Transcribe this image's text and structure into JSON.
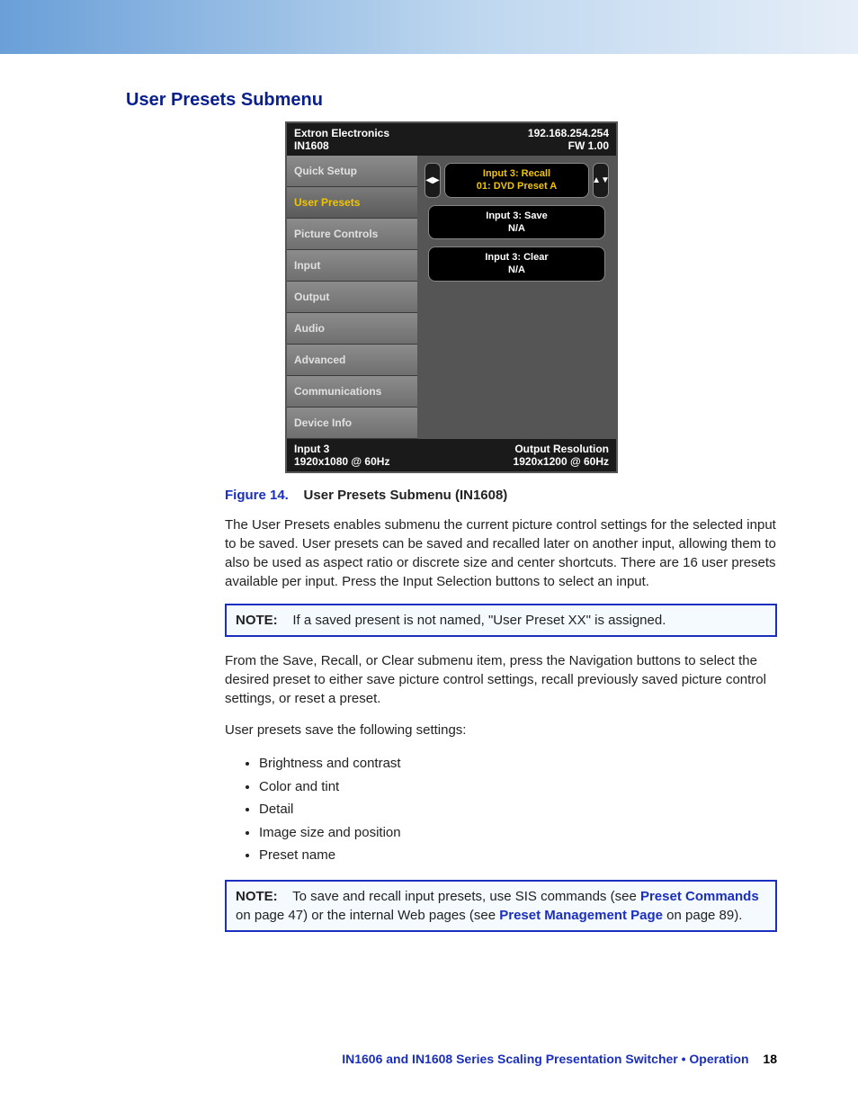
{
  "section_title": "User Presets Submenu",
  "device": {
    "brand": "Extron Electronics",
    "model": "IN1608",
    "ip": "192.168.254.254",
    "fw": "FW 1.00",
    "menu": [
      {
        "label": "Quick Setup",
        "selected": false
      },
      {
        "label": "User Presets",
        "selected": true
      },
      {
        "label": "Picture Controls",
        "selected": false
      },
      {
        "label": "Input",
        "selected": false
      },
      {
        "label": "Output",
        "selected": false
      },
      {
        "label": "Audio",
        "selected": false
      },
      {
        "label": "Advanced",
        "selected": false
      },
      {
        "label": "Communications",
        "selected": false
      },
      {
        "label": "Device Info",
        "selected": false
      }
    ],
    "pane": {
      "recall_l1": "Input 3: Recall",
      "recall_l2": "01: DVD Preset A",
      "save_l1": "Input 3: Save",
      "save_l2": "N/A",
      "clear_l1": "Input 3: Clear",
      "clear_l2": "N/A"
    },
    "footer": {
      "input_label": "Input 3",
      "input_res": "1920x1080 @ 60Hz",
      "output_label": "Output Resolution",
      "output_res": "1920x1200 @ 60Hz"
    }
  },
  "figure": {
    "number": "Figure 14.",
    "title": "User Presets Submenu (IN1608)"
  },
  "paragraphs": {
    "p1": "The User Presets enables submenu the current picture control settings for the selected input to be saved. User presets can be saved and recalled later on another input, allowing them to also be used as aspect ratio or discrete size and center shortcuts. There are 16 user presets available per input. Press the Input Selection buttons to select an input.",
    "p2": "From the Save, Recall, or Clear submenu item, press the Navigation buttons to select the desired preset to either save picture control settings, recall previously saved picture control settings, or reset a preset.",
    "p3": "User presets save the following settings:"
  },
  "note1": {
    "label": "NOTE:",
    "text": "If a saved present is not named, \"User Preset XX\" is assigned."
  },
  "bullets": [
    "Brightness and contrast",
    "Color and tint",
    "Detail",
    "Image size and position",
    "Preset name"
  ],
  "note2": {
    "label": "NOTE:",
    "t1": "To save and recall input presets, use SIS commands (see ",
    "link1": "Preset Commands",
    "t2": " on page 47) or the internal Web pages (see ",
    "link2": "Preset Management Page",
    "t3": " on page 89)."
  },
  "footer": {
    "title": "IN1606 and IN1608 Series Scaling Presentation Switcher • Operation",
    "page": "18"
  }
}
